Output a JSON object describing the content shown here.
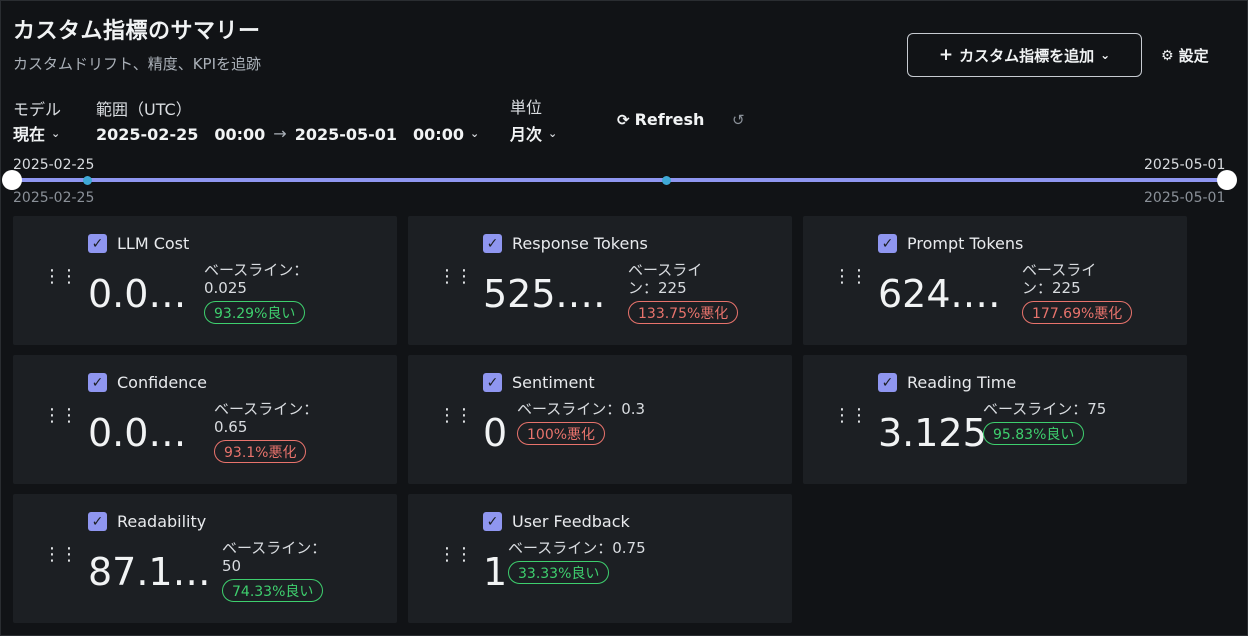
{
  "header": {
    "title": "カスタム指標のサマリー",
    "subtitle": "カスタムドリフト、精度、KPIを追跡",
    "add_button": "カスタム指標を追加",
    "settings_button": "設定"
  },
  "controls": {
    "model_label": "モデル",
    "model_value": "現在",
    "range_label": "範囲（UTC）",
    "range_start": "2025-02-25　00:00",
    "range_end": "2025-05-01　00:00",
    "unit_label": "単位",
    "unit_value": "月次",
    "refresh": "Refresh"
  },
  "slider": {
    "start_label": "2025-02-25",
    "end_label": "2025-05-01",
    "start_sub": "2025-02-25",
    "end_sub": "2025-05-01"
  },
  "metrics": [
    {
      "name": "LLM Cost",
      "value": "0.0…",
      "baseline": "ベースライン：",
      "baseline2": "0.025",
      "delta": "93.29%良い",
      "status": "good"
    },
    {
      "name": "Response Tokens",
      "value": "525.…",
      "baseline": "ベースライ",
      "baseline2": "ン：225",
      "delta": "133.75%悪化",
      "status": "bad"
    },
    {
      "name": "Prompt Tokens",
      "value": "624.…",
      "baseline": "ベースライ",
      "baseline2": "ン：225",
      "delta": "177.69%悪化",
      "status": "bad"
    },
    {
      "name": "Confidence",
      "value": "0.0…",
      "baseline": "ベースライン：",
      "baseline2": "0.65",
      "delta": "93.1%悪化",
      "status": "bad"
    },
    {
      "name": "Sentiment",
      "value": "0",
      "baseline": "ベースライン：0.3",
      "baseline2": "",
      "delta": "100%悪化",
      "status": "bad"
    },
    {
      "name": "Reading Time",
      "value": "3.125",
      "baseline": "ベースライン：75",
      "baseline2": "",
      "delta": "95.83%良い",
      "status": "good"
    },
    {
      "name": "Readability",
      "value": "87.1…",
      "baseline": "ベースライン：",
      "baseline2": "50",
      "delta": "74.33%良い",
      "status": "good"
    },
    {
      "name": "User Feedback",
      "value": "1",
      "baseline": "ベースライン：0.75",
      "baseline2": "",
      "delta": "33.33%良い",
      "status": "good"
    }
  ],
  "colors": {
    "accent": "#8f96f0",
    "good": "#3ecf6e",
    "bad": "#e8736c",
    "card_bg": "#1c1f23",
    "page_bg": "#111316"
  }
}
